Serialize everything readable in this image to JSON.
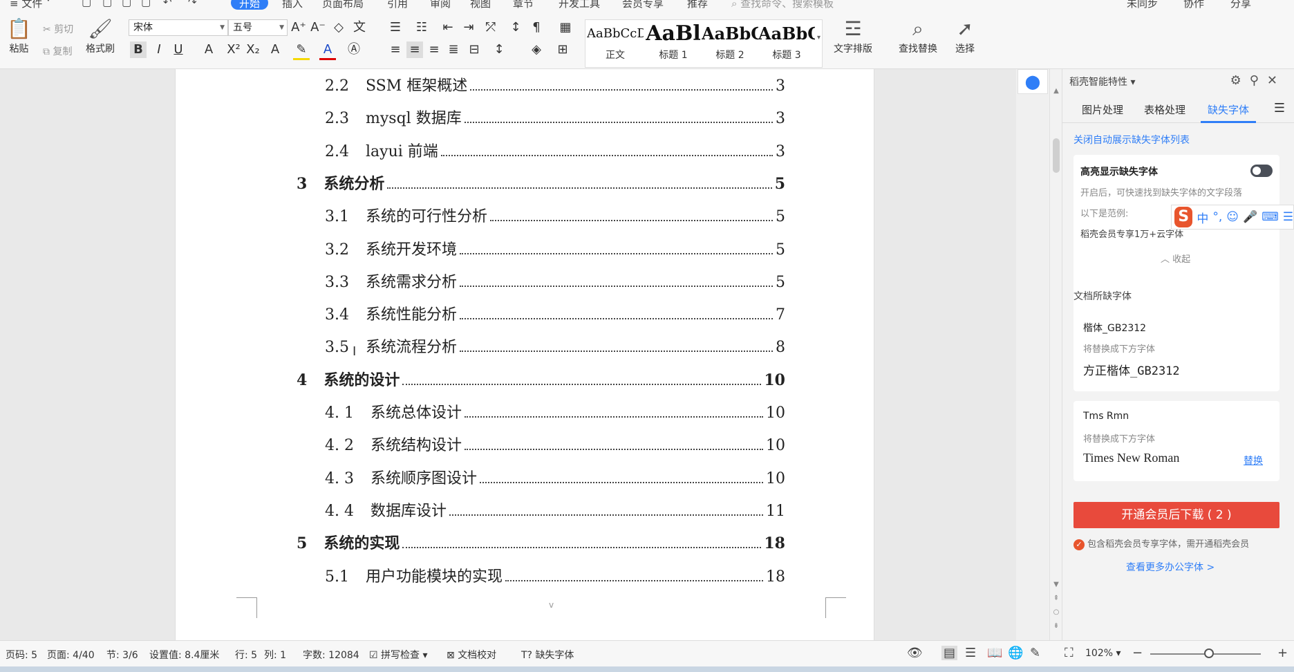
{
  "menu": {
    "file": "≡ 文件 ˅",
    "tabs": [
      "开始",
      "插入",
      "页面布局",
      "引用",
      "审阅",
      "视图",
      "章节",
      "开发工具",
      "会员专享",
      "推荐"
    ],
    "search": "查找命令、搜索模板",
    "right": [
      "未同步",
      "协作",
      "分享"
    ]
  },
  "ribbon": {
    "paste": "粘贴",
    "cut": "剪切",
    "copy": "复制",
    "format_painter": "格式刷",
    "font_name": "宋体",
    "font_size": "五号",
    "styles": [
      {
        "preview": "AaBbCcDd",
        "label": "正文"
      },
      {
        "preview": "AaBl",
        "label": "标题 1"
      },
      {
        "preview": "AaBbC",
        "label": "标题 2"
      },
      {
        "preview": "AaBbC",
        "label": "标题 3"
      }
    ],
    "text_layout": "文字排版",
    "find_replace": "查找替换",
    "select": "选择"
  },
  "toc": [
    {
      "num": "2.2",
      "title": "SSM 框架概述",
      "page": "3",
      "level": 2
    },
    {
      "num": "2.3",
      "title": "mysql 数据库",
      "page": "3",
      "level": 2
    },
    {
      "num": "2.4",
      "title": "layui 前端",
      "page": "3",
      "level": 2
    },
    {
      "num": "3",
      "title": "系统分析",
      "page": "5",
      "level": 1
    },
    {
      "num": "3.1",
      "title": "系统的可行性分析",
      "page": "5",
      "level": 2
    },
    {
      "num": "3.2",
      "title": "系统开发环境",
      "page": "5",
      "level": 2
    },
    {
      "num": "3.3",
      "title": "系统需求分析",
      "page": "5",
      "level": 2
    },
    {
      "num": "3.4",
      "title": "系统性能分析",
      "page": "7",
      "level": 2
    },
    {
      "num": "3.5",
      "title": "系统流程分析",
      "page": "8",
      "level": 2
    },
    {
      "num": "4",
      "title": "系统的设计",
      "page": "10",
      "level": 1
    },
    {
      "num": "4. 1",
      "title": "系统总体设计",
      "page": "10",
      "level": 2
    },
    {
      "num": "4. 2",
      "title": "系统结构设计",
      "page": "10",
      "level": 2
    },
    {
      "num": "4. 3",
      "title": "系统顺序图设计",
      "page": "10",
      "level": 2
    },
    {
      "num": "4. 4",
      "title": "数据库设计",
      "page": "11",
      "level": 2
    },
    {
      "num": "5",
      "title": "系统的实现",
      "page": "18",
      "level": 1
    },
    {
      "num": "5.1",
      "title": "用户功能模块的实现",
      "page": "18",
      "level": 2
    }
  ],
  "page_footer_mark": "v",
  "panel": {
    "title": "稻壳智能特性",
    "tabs": [
      "图片处理",
      "表格处理",
      "缺失字体"
    ],
    "close_auto": "关闭自动展示缺失字体列表",
    "highlight_title": "高亮显示缺失字体",
    "highlight_desc": "开启后，可快速找到缺失字体的文字段落",
    "example_label": "以下是范例:",
    "member_text": "稻壳会员专享1万+云字体",
    "collapse": "收起",
    "missing_title": "文档所缺字体",
    "fonts": [
      {
        "name": "楷体_GB2312",
        "replace_hint": "将替换成下方字体",
        "replacement": "方正楷体_GB2312",
        "action": ""
      },
      {
        "name": "Tms Rmn",
        "replace_hint": "将替换成下方字体",
        "replacement": "Times New Roman",
        "action": "替换"
      }
    ],
    "download_btn": "开通会员后下载 ( 2 )",
    "include_note": "包含稻壳会员专享字体，需开通稻壳会员",
    "more_fonts": "查看更多办公字体 >"
  },
  "ime": {
    "mode": "中",
    "punct": "°,"
  },
  "status": {
    "page_code": "页码: 5",
    "page": "页面: 4/40",
    "section": "节: 3/6",
    "setting": "设置值: 8.4厘米",
    "row": "行: 5",
    "col": "列: 1",
    "words": "字数: 12084",
    "spell": "拼写检查",
    "proof": "文档校对",
    "missing_font": "缺失字体",
    "zoom": "102%"
  }
}
